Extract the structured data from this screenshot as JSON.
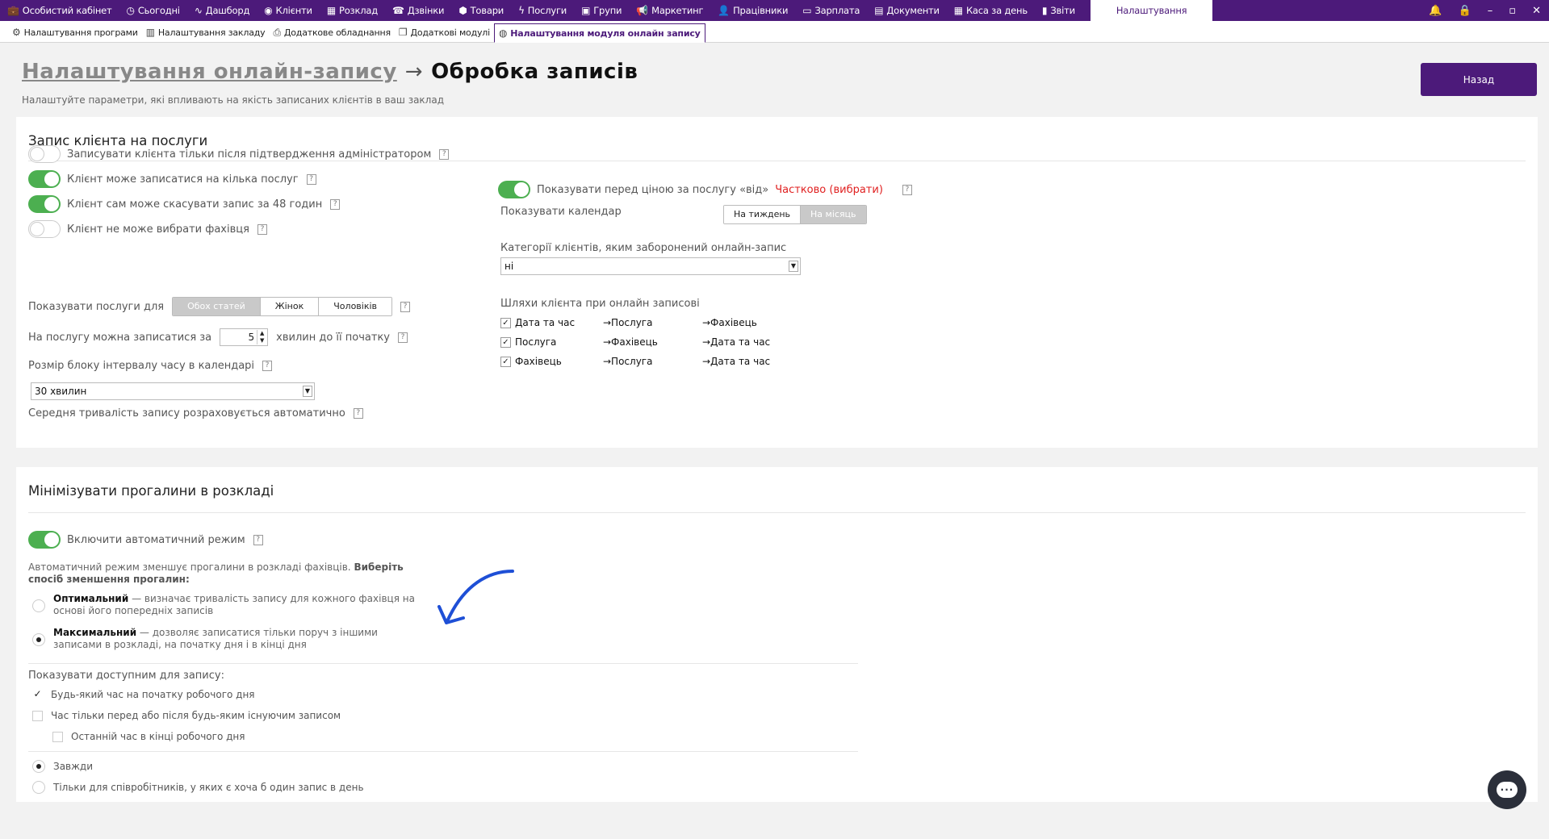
{
  "topnav": {
    "items": [
      {
        "icon": "briefcase-icon",
        "glyph": "💼",
        "label": "Особистий кабінет"
      },
      {
        "icon": "clock-icon",
        "glyph": "◷",
        "label": "Сьогодні"
      },
      {
        "icon": "pulse-icon",
        "glyph": "∿",
        "label": "Дашборд"
      },
      {
        "icon": "user-circle-icon",
        "glyph": "◉",
        "label": "Клієнти"
      },
      {
        "icon": "calendar-icon",
        "glyph": "▦",
        "label": "Розклад"
      },
      {
        "icon": "phone-list-icon",
        "glyph": "☎",
        "label": "Дзвінки"
      },
      {
        "icon": "box-icon",
        "glyph": "⬢",
        "label": "Товари"
      },
      {
        "icon": "lightning-icon",
        "glyph": "ϟ",
        "label": "Послуги"
      },
      {
        "icon": "image-icon",
        "glyph": "▣",
        "label": "Групи"
      },
      {
        "icon": "megaphone-icon",
        "glyph": "📢",
        "label": "Маркетинг"
      },
      {
        "icon": "user-icon",
        "glyph": "👤",
        "label": "Працівники"
      },
      {
        "icon": "money-icon",
        "glyph": "▭",
        "label": "Зарплата"
      },
      {
        "icon": "document-icon",
        "glyph": "▤",
        "label": "Документи"
      },
      {
        "icon": "calculator-icon",
        "glyph": "▦",
        "label": "Каса за день"
      },
      {
        "icon": "bar-chart-icon",
        "glyph": "▮",
        "label": "Звіти"
      }
    ],
    "active_label": "Налаштування"
  },
  "subtabs": [
    {
      "icon": "gear-icon",
      "glyph": "⚙",
      "label": "Налаштування програми",
      "active": false
    },
    {
      "icon": "building-icon",
      "glyph": "▥",
      "label": "Налаштування закладу",
      "active": false
    },
    {
      "icon": "printer-icon",
      "glyph": "⎙",
      "label": "Додаткове обладнання",
      "active": false
    },
    {
      "icon": "modules-icon",
      "glyph": "❐",
      "label": "Додаткові модулі",
      "active": false
    },
    {
      "icon": "globe-icon",
      "glyph": "◍",
      "label": "Налаштування модуля онлайн запису",
      "active": true
    }
  ],
  "page": {
    "breadcrumb": "Налаштування онлайн-запису",
    "arrow": "→",
    "title": "Обробка записів",
    "subtitle": "Налаштуйте параметри, які впливають на якість записаних клієнтів в ваш заклад",
    "back_label": "Назад"
  },
  "section1": {
    "title": "Запис клієнта на послуги",
    "toggles": [
      {
        "label": "Записувати клієнта тільки після підтвердження адміністратором",
        "on": false
      },
      {
        "label": "Клієнт може записатися на кілька послуг",
        "on": true
      },
      {
        "label": "Клієнт сам може скасувати запис за 48 годин",
        "on": true
      },
      {
        "label": "Клієнт не може вибрати фахівця",
        "on": false
      }
    ],
    "show_services_label": "Показувати послуги для",
    "show_services_options": [
      "Обох статей",
      "Жінок",
      "Чоловіків"
    ],
    "book_before_prefix": "На послугу можна записатися за",
    "book_before_value": "5",
    "book_before_suffix": "хвилин до її початку",
    "block_size_label": "Розмір блоку інтервалу часу в календарі",
    "block_size_value": "30 хвилин",
    "avg_duration_label": "Середня тривалість запису розраховується автоматично",
    "price_from_label": "Показувати перед ціною за послугу «від»",
    "price_from_link": "Частково (вибрати)",
    "price_from_on": true,
    "calendar_label": "Показувати календар",
    "calendar_options": [
      "На тиждень",
      "На місяць"
    ],
    "forbidden_label": "Категорії клієнтів, яким заборонений онлайн-запис",
    "forbidden_value": "ні",
    "paths_label": "Шляхи клієнта при онлайн записові",
    "paths": [
      [
        "Дата та час",
        "→Послуга",
        "→Фахівець"
      ],
      [
        "Послуга",
        "→Фахівець",
        "→Дата та час"
      ],
      [
        "Фахівець",
        "→Послуга",
        "→Дата та час"
      ]
    ]
  },
  "section2": {
    "title": "Мінімізувати прогалини в розкладі",
    "auto_label": "Включити автоматичний режим",
    "auto_on": true,
    "hint_text": "Автоматичний режим зменшує прогалини в розкладі фахівців.",
    "hint_bold": "Виберіть спосіб зменшення прогалин:",
    "modes": [
      {
        "name": "Оптимальний",
        "desc": " — визначає тривалість запису для кожного фахівця на основі його попередніх записів",
        "selected": false
      },
      {
        "name": "Максимальний",
        "desc": " — дозволяє записатися тільки поруч з іншими записами в розкладі, на початку дня і в кінці дня",
        "selected": true
      }
    ],
    "show_available_label": "Показувати доступним для запису:",
    "available": [
      {
        "label": "Будь-який час на початку робочого дня",
        "checked": true
      },
      {
        "label": "Час тільки перед або після будь-яким існуючим записом",
        "checked": false
      },
      {
        "label": "Останній час в кінці робочого дня",
        "checked": false
      }
    ],
    "when": [
      {
        "label": "Завжди",
        "selected": true
      },
      {
        "label": "Тільки для співробітників, у яких є хоча б один запис в день",
        "selected": false
      }
    ]
  },
  "colors": {
    "brand": "#4c1a7a",
    "toggle_on": "#4caf50",
    "link_red": "#e02020",
    "annotation_arrow": "#1e4fd6"
  }
}
